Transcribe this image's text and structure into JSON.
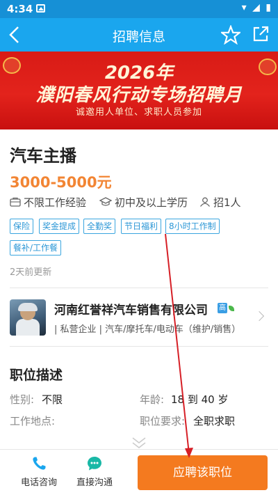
{
  "status_bar": {
    "time": "4:34",
    "icons": "▾ ◢ ▮"
  },
  "header": {
    "title": "招聘信息",
    "back_icon": "chevron-left-icon",
    "favorite_icon": "star-outline-icon",
    "share_icon": "share-icon"
  },
  "banner": {
    "year": "2026年",
    "headline": "濮阳春风行动专场招聘月",
    "subtitle": "诚邀用人单位、求职人员参加"
  },
  "job": {
    "title": "汽车主播",
    "salary": "3000-5000元",
    "requirements": [
      {
        "icon": "briefcase-icon",
        "text": "不限工作经验"
      },
      {
        "icon": "graduation-cap-icon",
        "text": "初中及以上学历"
      },
      {
        "icon": "person-icon",
        "text": "招1人"
      }
    ],
    "tags": [
      "保险",
      "奖金提成",
      "全勤奖",
      "节日福利",
      "8小时工作制",
      "餐补/工作餐"
    ],
    "updated": "2天前更新"
  },
  "company": {
    "name": "河南红誉祥汽车销售有限公司",
    "badge": "高",
    "meta": "| 私营企业 | 汽车/摩托车/电动车（维护/销售）"
  },
  "description": {
    "section_title": "职位描述",
    "fields": [
      {
        "label": "性别:",
        "value": "不限"
      },
      {
        "label": "年龄:",
        "value": "18 到 40 岁"
      },
      {
        "label": "工作地点:",
        "value": ""
      },
      {
        "label": "职位要求:",
        "value": "全职求职"
      }
    ]
  },
  "bottom_bar": {
    "phone_label": "电话咨询",
    "chat_label": "直接沟通",
    "apply_label": "应聘该职位"
  },
  "colors": {
    "header_blue": "#1aa6ee",
    "statusbar_blue": "#1690d6",
    "salary_orange": "#f28534",
    "tag_blue": "#2c97d6",
    "apply_orange": "#f47a1f",
    "banner_red": "#e3231c",
    "annotation_arrow": "#d61f26"
  }
}
